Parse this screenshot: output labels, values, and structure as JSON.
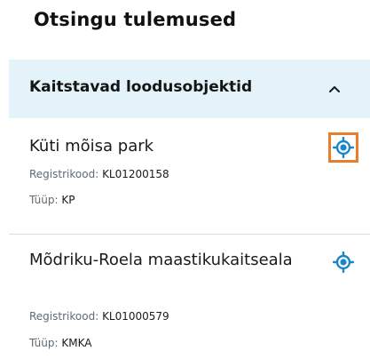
{
  "page_title": "Otsingu tulemused",
  "section": {
    "title": "Kaitstavad loodusobjektid",
    "collapse_icon": "chevron-up-icon"
  },
  "results": [
    {
      "name": "Küti mõisa park",
      "code_label": "Registrikood:",
      "code": "KL01200158",
      "type_label": "Tüüp:",
      "type": "KP",
      "locate_icon": "locate-target-icon"
    },
    {
      "name": "Mõdriku-Roela maastikukaitseala",
      "code_label": "Registrikood:",
      "code": "KL01000579",
      "type_label": "Tüüp:",
      "type": "KMKA",
      "locate_icon": "locate-target-icon"
    }
  ],
  "colors": {
    "accent": "#1a86c8",
    "section_bg": "#e4f2fa",
    "focus_outline": "#e87d2c"
  }
}
